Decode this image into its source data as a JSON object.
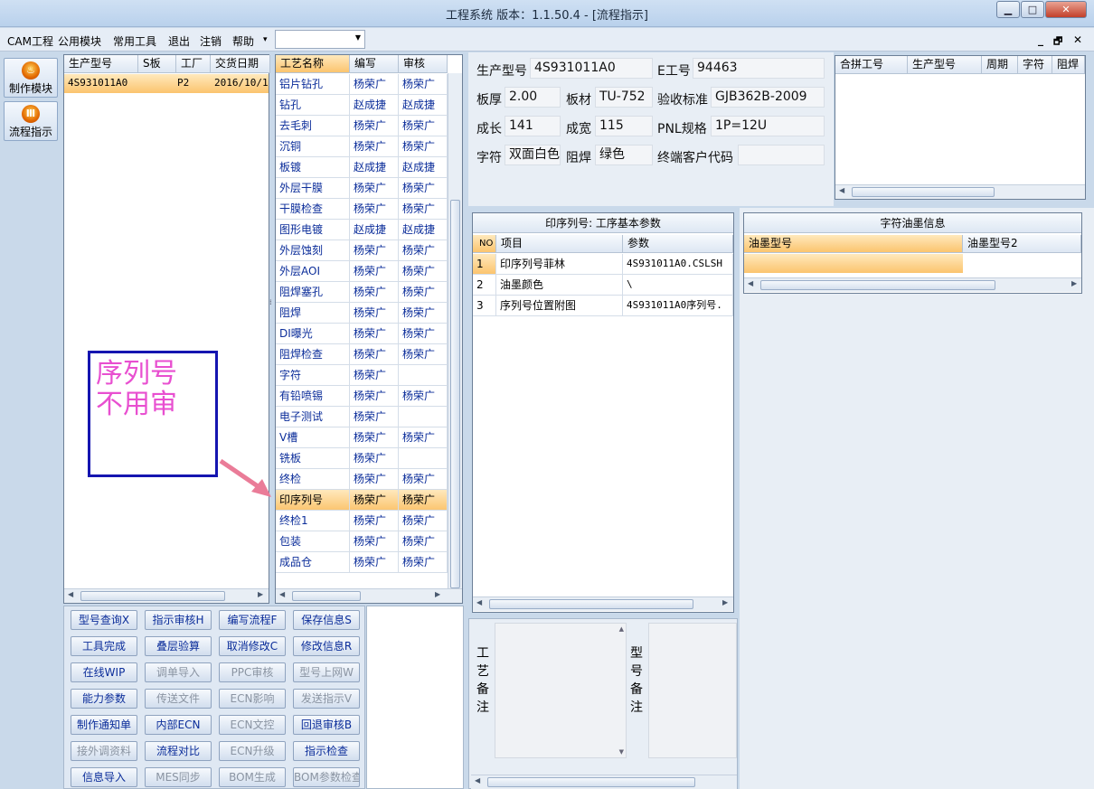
{
  "window": {
    "title": "工程系统   版本：1.1.50.4 - [流程指示]",
    "btn_min": "▁",
    "btn_max": "□",
    "btn_close": "✕"
  },
  "menu": {
    "items": [
      "CAM工程",
      "公用模块",
      "常用工具",
      "退出",
      "注销",
      "帮助"
    ],
    "help_arrow": "▾",
    "combo_value": "",
    "mdi_min": "_",
    "mdi_restore": "🗗",
    "mdi_close": "✕"
  },
  "toolbar": {
    "make_module": "制作模块",
    "flow_guide": "流程指示"
  },
  "orders": {
    "headers": [
      "生产型号",
      "S板",
      "工厂",
      "交货日期"
    ],
    "rows": [
      [
        "4S931011A0",
        "",
        "P2",
        "2016/10/1"
      ]
    ]
  },
  "process": {
    "headers": [
      "工艺名称",
      "编写",
      "审核"
    ],
    "rows": [
      [
        "铝片钻孔",
        "杨荣广",
        "杨荣广"
      ],
      [
        "钻孔",
        "赵成捷",
        "赵成捷"
      ],
      [
        "去毛刺",
        "杨荣广",
        "杨荣广"
      ],
      [
        "沉铜",
        "杨荣广",
        "杨荣广"
      ],
      [
        "板镀",
        "赵成捷",
        "赵成捷"
      ],
      [
        "外层干膜",
        "杨荣广",
        "杨荣广"
      ],
      [
        "干膜检查",
        "杨荣广",
        "杨荣广"
      ],
      [
        "图形电镀",
        "赵成捷",
        "赵成捷"
      ],
      [
        "外层蚀刻",
        "杨荣广",
        "杨荣广"
      ],
      [
        "外层AOI",
        "杨荣广",
        "杨荣广"
      ],
      [
        "阻焊塞孔",
        "杨荣广",
        "杨荣广"
      ],
      [
        "阻焊",
        "杨荣广",
        "杨荣广"
      ],
      [
        "DI曝光",
        "杨荣广",
        "杨荣广"
      ],
      [
        "阻焊检查",
        "杨荣广",
        "杨荣广"
      ],
      [
        "字符",
        "杨荣广",
        ""
      ],
      [
        "有铅喷锡",
        "杨荣广",
        "杨荣广"
      ],
      [
        "电子测试",
        "杨荣广",
        ""
      ],
      [
        "V槽",
        "杨荣广",
        "杨荣广"
      ],
      [
        "铣板",
        "杨荣广",
        ""
      ],
      [
        "终检",
        "杨荣广",
        "杨荣广"
      ],
      [
        "印序列号",
        "杨荣广",
        "杨荣广"
      ],
      [
        "终检1",
        "杨荣广",
        "杨荣广"
      ],
      [
        "包装",
        "杨荣广",
        "杨荣广"
      ],
      [
        "成品仓",
        "杨荣广",
        "杨荣广"
      ]
    ],
    "selected_index": 20
  },
  "annotation": {
    "line1": "序列号",
    "line2": "不用审"
  },
  "info": {
    "prod_model_label": "生产型号",
    "prod_model": "4S931011A0",
    "e_no_label": "E工号",
    "e_no": "94463",
    "thickness_label": "板厚",
    "thickness": "2.00",
    "material_label": "板材",
    "material": "TU-752",
    "standard_label": "验收标准",
    "standard": "GJB362B-2009",
    "length_label": "成长",
    "length": "141",
    "width_label": "成宽",
    "width": "115",
    "pnl_label": "PNL规格",
    "pnl": "1P=12U",
    "char_label": "字符",
    "char": "双面白色",
    "mask_label": "阻焊",
    "mask": "绿色",
    "customer_label": "终端客户代码",
    "customer": ""
  },
  "merge": {
    "headers": [
      "合拼工号",
      "生产型号",
      "周期",
      "字符",
      "阻焊"
    ]
  },
  "params": {
    "title": "印序列号: 工序基本参数",
    "headers": [
      "NO",
      "项目",
      "参数"
    ],
    "rows": [
      [
        "1",
        "印序列号菲林",
        "4S931011A0.CSLSH"
      ],
      [
        "2",
        "油墨颜色",
        "\\"
      ],
      [
        "3",
        "序列号位置附图",
        "4S931011A0序列号."
      ]
    ]
  },
  "ink": {
    "title": "字符油墨信息",
    "headers": [
      "油墨型号",
      "油墨型号2"
    ]
  },
  "buttons": [
    [
      "型号查询X",
      "指示审核H",
      "编写流程F",
      "保存信息S"
    ],
    [
      "工具完成",
      "叠层验算",
      "取消修改C",
      "修改信息R"
    ],
    [
      "在线WIP",
      "调单导入",
      "PPC审核",
      "型号上网W"
    ],
    [
      "能力参数",
      "传送文件",
      "ECN影响",
      "发送指示V"
    ],
    [
      "制作通知单",
      "内部ECN",
      "ECN文控",
      "回退审核B"
    ],
    [
      "接外调资料",
      "流程对比",
      "ECN升级",
      "指示检查"
    ],
    [
      "信息导入",
      "MES同步",
      "BOM生成",
      "BOM参数检查"
    ]
  ],
  "buttons_disabled": [
    [
      false,
      false,
      false,
      false
    ],
    [
      false,
      false,
      false,
      false
    ],
    [
      false,
      true,
      true,
      true
    ],
    [
      false,
      true,
      true,
      true
    ],
    [
      false,
      false,
      true,
      false
    ],
    [
      true,
      false,
      true,
      false
    ],
    [
      false,
      true,
      true,
      true
    ]
  ],
  "remarks": {
    "process_label": [
      "工",
      "艺",
      "备",
      "注"
    ],
    "model_label": [
      "型",
      "号",
      "备",
      "注"
    ]
  }
}
